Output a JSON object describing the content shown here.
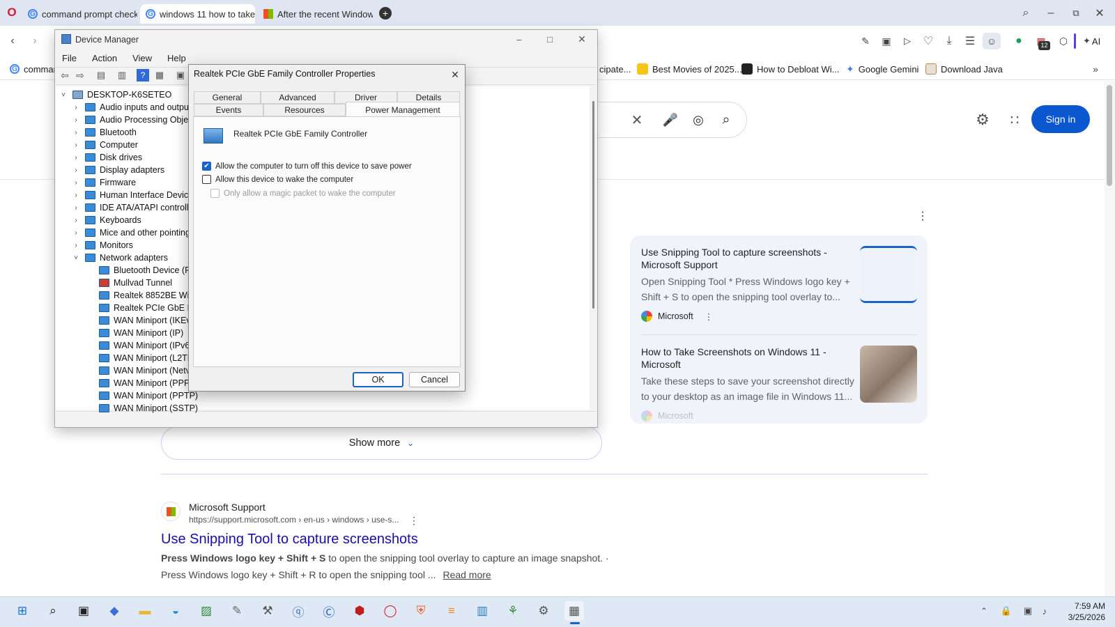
{
  "browser": {
    "tabs": [
      {
        "label": "command prompt check v"
      },
      {
        "label": "windows 11 how to take a"
      },
      {
        "label": "After the recent Windows"
      }
    ],
    "new_tab": "+",
    "ai_label": "AI",
    "bookmarks": [
      {
        "label": "comman"
      },
      {
        "label": "cipate..."
      },
      {
        "label": "Best Movies of 2025..."
      },
      {
        "label": "How to Debloat Wi..."
      },
      {
        "label": "Google Gemini"
      },
      {
        "label": "Download Java"
      }
    ],
    "badge_count": "12"
  },
  "google": {
    "sign_in": "Sign in",
    "cards": [
      {
        "title": "Use Snipping Tool to capture screenshots - Microsoft Support",
        "desc": "Open Snipping Tool * Press Windows logo key + Shift + S to open the snipping tool overlay to...",
        "source": "Microsoft"
      },
      {
        "title": "How to Take Screenshots on Windows 11 - Microsoft",
        "desc": "Take these steps to save your screenshot directly to your desktop as an image file in Windows 11...",
        "source": "Microsoft"
      }
    ],
    "show_more": "Show more",
    "result": {
      "site": "Microsoft Support",
      "url": "https://support.microsoft.com › en-us › windows › use-s...",
      "title": "Use Snipping Tool to capture screenshots",
      "snippet_bold1": "Press Windows logo key + Shift + S",
      "snippet1": " to open the snipping tool overlay to capture an image snapshot. ·",
      "snippet2": "Press Windows logo key + Shift + R to open the snipping tool ...",
      "read_more": "Read more"
    }
  },
  "device_manager": {
    "title": "Device Manager",
    "menu": [
      "File",
      "Action",
      "View",
      "Help"
    ],
    "root": "DESKTOP-K6SETEO",
    "items": [
      "Audio inputs and outpu",
      "Audio Processing Objec",
      "Bluetooth",
      "Computer",
      "Disk drives",
      "Display adapters",
      "Firmware",
      "Human Interface Device",
      "IDE ATA/ATAPI controlle",
      "Keyboards",
      "Mice and other pointing",
      "Monitors",
      "Network adapters"
    ],
    "network_children": [
      "Bluetooth Device (Pe",
      "Mullvad Tunnel",
      "Realtek 8852BE Wirel",
      "Realtek PCIe GbE Far",
      "WAN Miniport (IKEv",
      "WAN Miniport (IP)",
      "WAN Miniport (IPv6",
      "WAN Miniport (L2TP",
      "WAN Miniport (Netv",
      "WAN Miniport (PPP(",
      "WAN Miniport (PPTP)",
      "WAN Miniport (SSTP)"
    ]
  },
  "dialog": {
    "title": "Realtek PCIe GbE Family Controller Properties",
    "tabs_row1": [
      "General",
      "Advanced",
      "Driver",
      "Details"
    ],
    "tabs_row2": [
      "Events",
      "Resources",
      "Power Management"
    ],
    "device_name": "Realtek PCIe GbE Family Controller",
    "options": [
      {
        "label": "Allow the computer to turn off this device to save power",
        "checked": true,
        "enabled": true
      },
      {
        "label": "Allow this device to wake the computer",
        "checked": false,
        "enabled": true
      },
      {
        "label": "Only allow a magic packet to wake the computer",
        "checked": false,
        "enabled": false
      }
    ],
    "ok": "OK",
    "cancel": "Cancel"
  },
  "taskbar": {
    "time": "7:59 AM",
    "date": "3/25/2026"
  }
}
